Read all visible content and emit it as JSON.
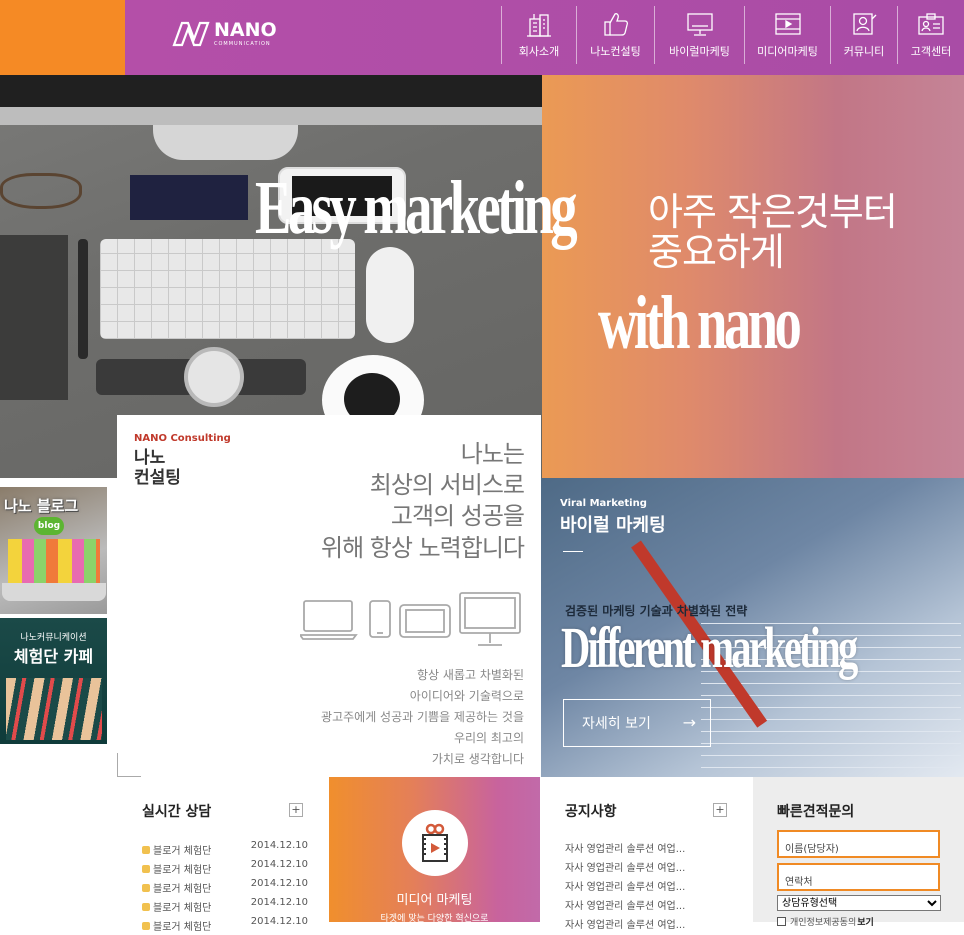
{
  "header": {
    "logo_text": "NANO",
    "logo_sub": "COMMUNICATION",
    "nav": [
      {
        "label": "회사소개",
        "icon": "building-icon"
      },
      {
        "label": "나노컨설팅",
        "icon": "thumbs-up-icon"
      },
      {
        "label": "바이럴마케팅",
        "icon": "monitor-icon"
      },
      {
        "label": "미디어마케팅",
        "icon": "film-icon"
      },
      {
        "label": "커뮤니티",
        "icon": "profile-icon"
      },
      {
        "label": "고객센터",
        "icon": "id-card-icon"
      }
    ]
  },
  "hero": {
    "title1": "Easy marketing",
    "ko_line1": "아주 작은것부터",
    "ko_line2": "중요하게",
    "title2": "with nano"
  },
  "consulting": {
    "en_label": "NANO Consulting",
    "ko_line1": "나노",
    "ko_line2": "컨설팅",
    "big_lines": [
      "나노는",
      "최상의 서비스로",
      "고객의 성공을",
      "위해 항상 노력합니다"
    ],
    "desc_lines": [
      "항상 새롭고 차별화된",
      "아이디어와 기술력으로",
      "광고주에게 성공과 기쁨을 제공하는 것을",
      "우리의 최고의",
      "가치로 생각합니다"
    ]
  },
  "side": {
    "blog_title": "나노 블로그",
    "blog_badge": "blog",
    "cafe_sub": "나노커뮤니케이션",
    "cafe_title": "체험단 카페"
  },
  "viral": {
    "en_label": "Viral Marketing",
    "ko_title": "바이럴 마케팅",
    "sub": "검증된 마케팅 기술과 차별화된 전략",
    "big": "Different marketing",
    "button": "자세히 보기",
    "button_arrow": "→"
  },
  "realtime": {
    "title": "실시간 상담",
    "plus": "+",
    "rows": [
      {
        "name": "블로거 체험단",
        "date": "2014.12.10"
      },
      {
        "name": "블로거 체험단",
        "date": "2014.12.10"
      },
      {
        "name": "블로거 체험단",
        "date": "2014.12.10"
      },
      {
        "name": "블로거 체험단",
        "date": "2014.12.10"
      },
      {
        "name": "블로거 체험단",
        "date": "2014.12.10"
      }
    ]
  },
  "media": {
    "title": "미디어 마케팅",
    "sub": "타겟에 맞는 다양한 혁신으로"
  },
  "notice": {
    "title": "공지사항",
    "plus": "+",
    "rows": [
      "자사 영업관리 솔루션 여업...",
      "자사 영업관리 솔루션 여업...",
      "자사 영업관리 솔루션 여업...",
      "자사 영업관리 솔루션 여업...",
      "자사 영업관리 솔루션 여업..."
    ]
  },
  "quick": {
    "title": "빠른견적문의",
    "name_placeholder": "이름(담당자)",
    "phone_placeholder": "연락처",
    "select_value": "상담유형선택",
    "agree": "개인정보제공동의",
    "agree_bold": "보기"
  },
  "colors": {
    "orange": "#f58a25",
    "purple": "#b24aa6",
    "consult_red": "#c0392b"
  }
}
